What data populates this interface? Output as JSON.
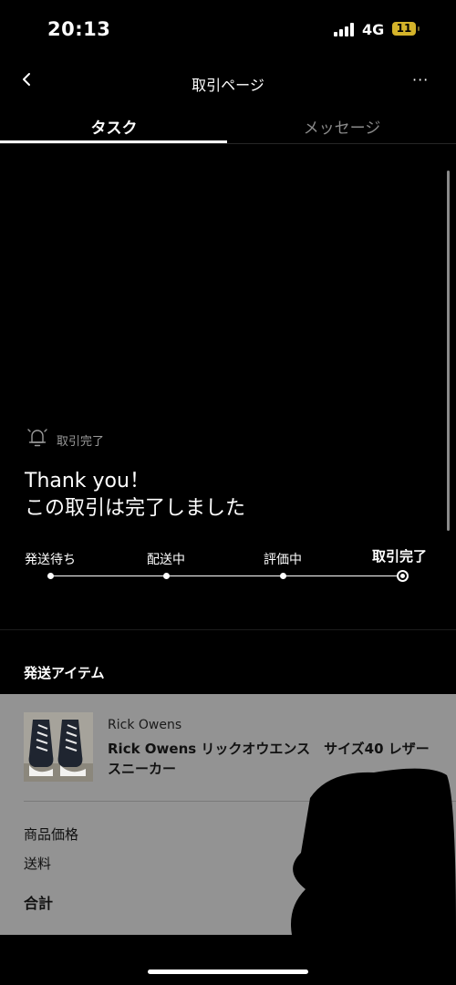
{
  "status_bar": {
    "time": "20:13",
    "network": "4G",
    "battery": "11"
  },
  "nav": {
    "title": "取引ページ",
    "more": "···"
  },
  "tabs": [
    {
      "label": "タスク"
    },
    {
      "label": "メッセージ"
    }
  ],
  "transaction": {
    "status_label": "取引完了",
    "thanks_line1": "Thank you！",
    "thanks_line2": "この取引は完了しました",
    "steps": [
      {
        "label": "発送待ち"
      },
      {
        "label": "配送中"
      },
      {
        "label": "評価中"
      },
      {
        "label": "取引完了"
      }
    ],
    "current_step": 4
  },
  "shipping": {
    "title": "発送アイテム",
    "item": {
      "brand": "Rick Owens",
      "name": "Rick Owens リックオウエンス　サイズ40 レザー　スニーカー"
    },
    "rows": {
      "price_label": "商品価格",
      "shipping_label": "送料",
      "total_label": "合計"
    }
  },
  "colors": {
    "background": "#000000",
    "panel": "#939393",
    "battery": "#d4b32a"
  },
  "icons": [
    "back-chevron-icon",
    "more-icon",
    "bell-icon",
    "signal-icon",
    "battery-icon"
  ]
}
